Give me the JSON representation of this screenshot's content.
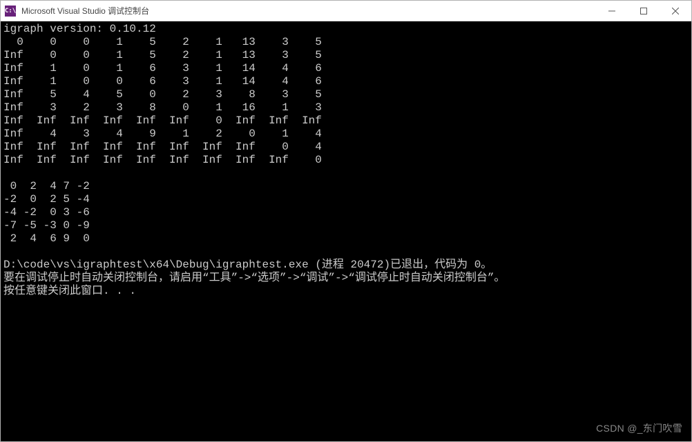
{
  "window": {
    "title": "Microsoft Visual Studio 调试控制台",
    "icon_label": "C:\\"
  },
  "console": {
    "version_line": "igraph version: 0.10.12",
    "matrix1": [
      "  0    0    0    1    5    2    1   13    3    5",
      "Inf    0    0    1    5    2    1   13    3    5",
      "Inf    1    0    1    6    3    1   14    4    6",
      "Inf    1    0    0    6    3    1   14    4    6",
      "Inf    5    4    5    0    2    3    8    3    5",
      "Inf    3    2    3    8    0    1   16    1    3",
      "Inf  Inf  Inf  Inf  Inf  Inf    0  Inf  Inf  Inf",
      "Inf    4    3    4    9    1    2    0    1    4",
      "Inf  Inf  Inf  Inf  Inf  Inf  Inf  Inf    0    4",
      "Inf  Inf  Inf  Inf  Inf  Inf  Inf  Inf  Inf    0"
    ],
    "matrix2": [
      " 0  2  4 7 -2",
      "-2  0  2 5 -4",
      "-4 -2  0 3 -6",
      "-7 -5 -3 0 -9",
      " 2  4  6 9  0"
    ],
    "exit_line": "D:\\code\\vs\\igraphtest\\x64\\Debug\\igraphtest.exe (进程 20472)已退出，代码为 0。",
    "hint_line": "要在调试停止时自动关闭控制台，请启用“工具”->“选项”->“调试”->“调试停止时自动关闭控制台”。",
    "press_key": "按任意键关闭此窗口. . ."
  },
  "watermark": "CSDN @_东门吹雪"
}
